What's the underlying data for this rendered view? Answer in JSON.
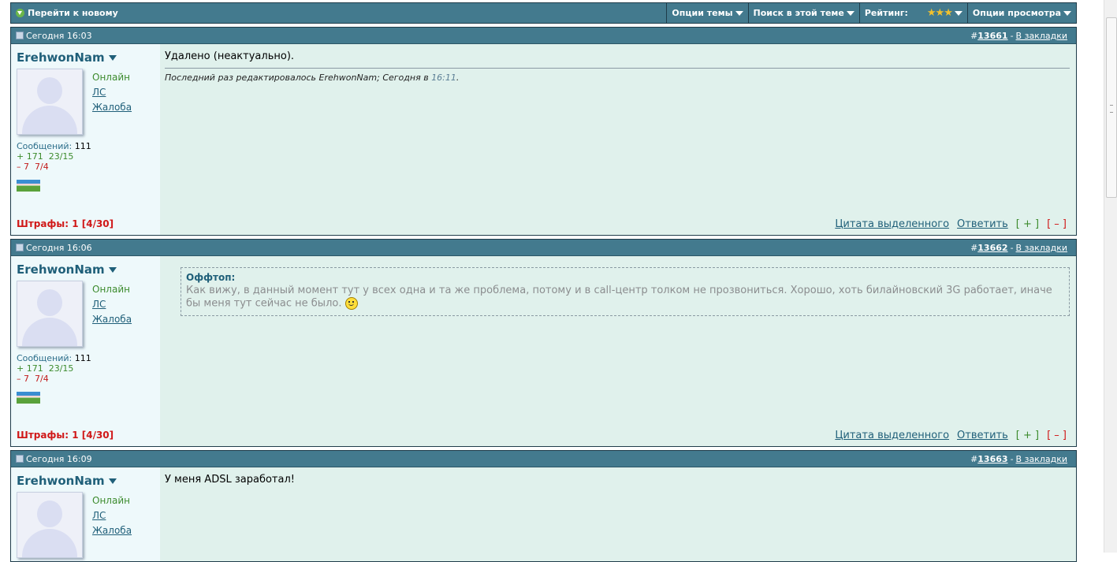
{
  "toolbar": {
    "newest": "Перейти к новому",
    "thread_options": "Опции темы",
    "search_thread": "Поиск в этой теме",
    "rating_label": "Рейтинг:",
    "rating_stars": "★★★",
    "view_options": "Опции просмотра"
  },
  "posts": [
    {
      "date": "Сегодня 16:03",
      "number": "13661",
      "bookmark": "В закладки",
      "user": {
        "name": "ErehwonNam",
        "status": "Онлайн",
        "pm": "ЛС",
        "report": "Жалоба",
        "messages_label": "Сообщений:",
        "messages": "111",
        "plus": "+ 171",
        "plus_detail": "23/15",
        "minus": "– 7",
        "minus_detail": "7/4",
        "fines": "Штрафы: 1 [4/30]"
      },
      "message": "Удалено (неактуально).",
      "edited_prefix": "Последний раз редактировалось ErehwonNam; Сегодня в ",
      "edited_time": "16:11",
      "edited_suffix": "."
    },
    {
      "date": "Сегодня 16:06",
      "number": "13662",
      "bookmark": "В закладки",
      "user": {
        "name": "ErehwonNam",
        "status": "Онлайн",
        "pm": "ЛС",
        "report": "Жалоба",
        "messages_label": "Сообщений:",
        "messages": "111",
        "plus": "+ 171",
        "plus_detail": "23/15",
        "minus": "– 7",
        "minus_detail": "7/4",
        "fines": "Штрафы: 1 [4/30]"
      },
      "offtop_title": "Оффтоп:",
      "offtop_text": "Как вижу, в данный момент тут у всех одна и та же проблема, потому и в call-центр толком не прозвониться. Хорошо, хоть билайновский 3G работает, иначе бы меня тут сейчас не было."
    },
    {
      "date": "Сегодня 16:09",
      "number": "13663",
      "bookmark": "В закладки",
      "user": {
        "name": "ErehwonNam",
        "status": "Онлайн",
        "pm": "ЛС",
        "report": "Жалоба"
      },
      "message": "У меня ADSL заработал!"
    }
  ],
  "actions": {
    "quote_selected": "Цитата выделенного",
    "reply": "Ответить",
    "vote_plus": "[ + ]",
    "vote_minus": "[ – ]"
  },
  "hash": "#"
}
